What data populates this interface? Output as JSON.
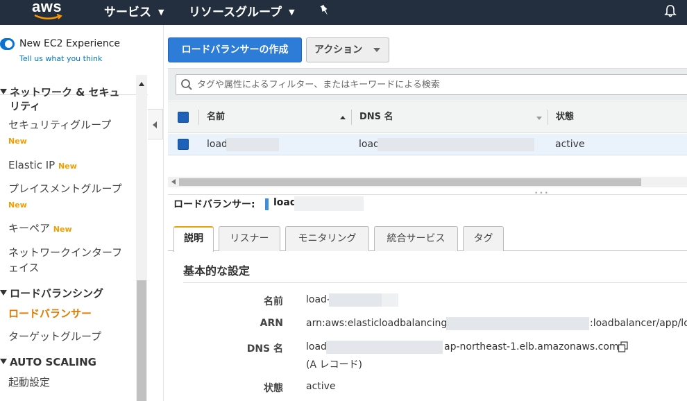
{
  "topnav": {
    "logo": "aws",
    "services_label": "サービス",
    "resource_groups_label": "リソースグループ"
  },
  "sidebar": {
    "new_experience_label": "New EC2 Experience",
    "tell_us_label": "Tell us what you think",
    "sections": [
      {
        "title_line1": "ネットワーク & セキュ",
        "title_line2": "リティ",
        "items": [
          {
            "label": "セキュリティグループ",
            "badge": "New"
          },
          {
            "label": "Elastic IP",
            "badge": "New"
          },
          {
            "label": "プレイスメントグループ",
            "badge": "New"
          },
          {
            "label": "キーペア",
            "badge": "New"
          },
          {
            "label_line1": "ネットワークインターフ",
            "label_line2": "ェイス"
          }
        ]
      },
      {
        "title": "ロードバランシング",
        "items": [
          {
            "label": "ロードバランサー",
            "active": true
          },
          {
            "label": "ターゲットグループ"
          }
        ]
      },
      {
        "title": "AUTO SCALING",
        "items": [
          {
            "label": "起動設定"
          }
        ]
      }
    ]
  },
  "toolbar": {
    "create_label": "ロードバランサーの作成",
    "actions_label": "アクション"
  },
  "search": {
    "placeholder": "タグや属性によるフィルター、またはキーワードによる検索"
  },
  "table": {
    "columns": [
      "名前",
      "DNS 名",
      "状態"
    ],
    "rows": [
      {
        "name": "load-",
        "dns": "load",
        "state": "active"
      }
    ]
  },
  "detail": {
    "title": "ロードバランサー:",
    "lb_name": "load",
    "tabs": [
      "説明",
      "リスナー",
      "モニタリング",
      "統合サービス",
      "タグ"
    ],
    "section_title": "基本的な設定",
    "fields": {
      "name_label": "名前",
      "name_value": "load-",
      "arn_label": "ARN",
      "arn_prefix": "arn:aws:elasticloadbalancing:",
      "arn_suffix": ":loadbalancer/app/loa",
      "dns_label": "DNS 名",
      "dns_prefix": "load",
      "dns_suffix": "ap-northeast-1.elb.amazonaws.com",
      "dns_record": "(A レコード)",
      "state_label": "状態",
      "state_value": "active"
    }
  },
  "colors": {
    "nav_bg": "#232f3e",
    "primary_button": "#2d7cd8",
    "active_link": "#e07b00",
    "new_badge": "#f0a000"
  }
}
